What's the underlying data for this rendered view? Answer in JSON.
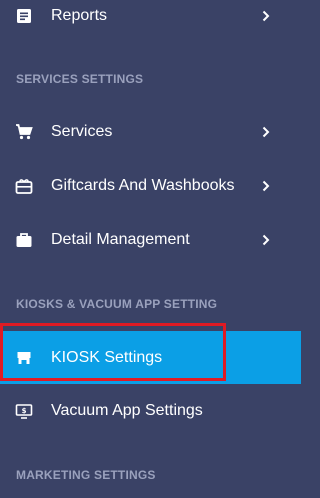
{
  "menu": {
    "reports_label": "Reports",
    "services_section": "SERVICES SETTINGS",
    "services_label": "Services",
    "giftcards_label": "Giftcards And Washbooks",
    "detail_label": "Detail Management",
    "kiosks_section": "KIOSKS & VACUUM APP SETTING",
    "kiosk_settings_label": "KIOSK Settings",
    "vacuum_label": "Vacuum App Settings",
    "marketing_section": "MARKETING SETTINGS"
  },
  "colors": {
    "sidebar_bg": "#3a4266",
    "active_bg": "#0b9fe6",
    "section_text": "#9aa1bd",
    "highlight_border": "#e01b24"
  },
  "icons": {
    "reports": "report-icon",
    "services": "cart-icon",
    "giftcards": "gift-icon",
    "detail": "briefcase-icon",
    "kiosk": "kiosk-icon",
    "vacuum": "vacuum-app-icon",
    "chevron": "chevron-right-icon"
  }
}
